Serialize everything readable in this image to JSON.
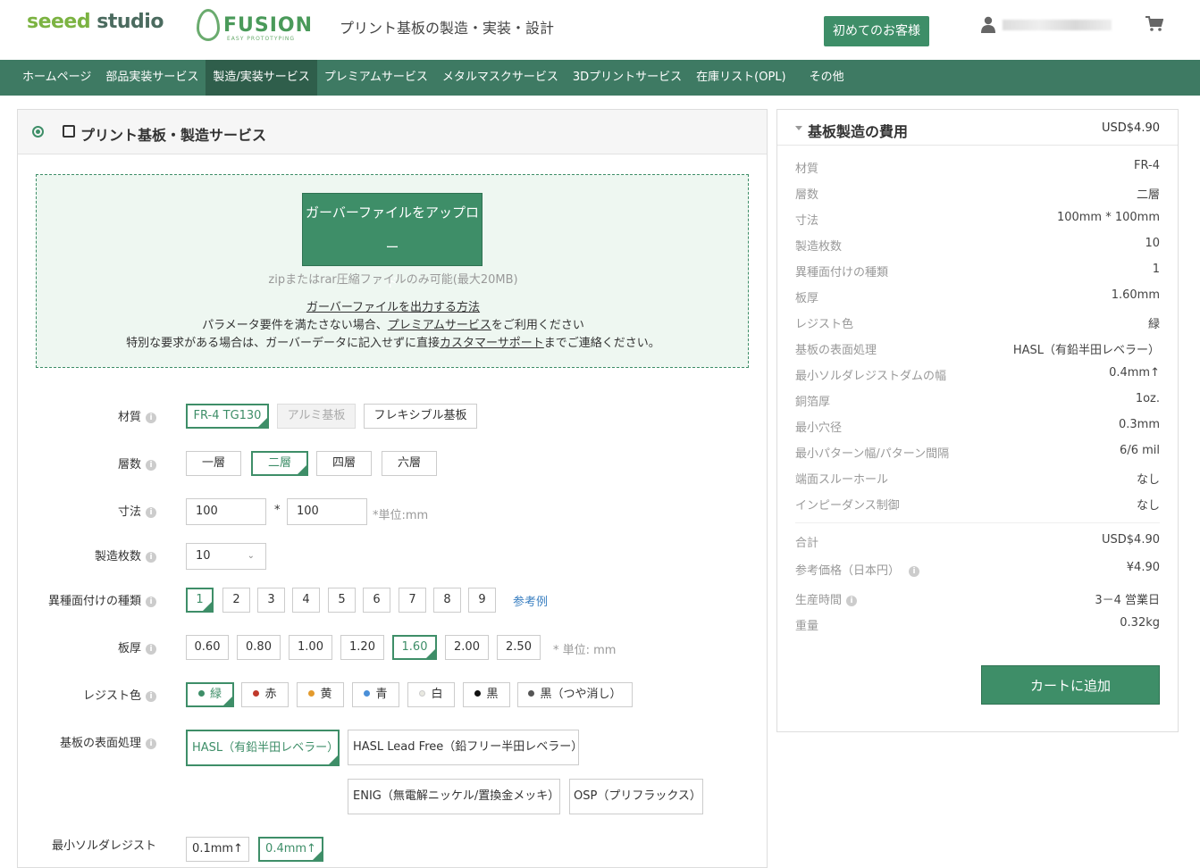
{
  "header": {
    "logo_seeed": "seeed",
    "logo_studio": "studio",
    "logo_fusion": "FUSION",
    "logo_fusion_sub": "EASY PROTOTYPING",
    "tagline": "プリント基板の製造・実装・設計",
    "first_customer_button": "初めてのお客様"
  },
  "nav": [
    "ホームページ",
    "部品実装サービス",
    "製造/実装サービス",
    "プレミアムサービス",
    "メタルマスクサービス",
    "3Dプリントサービス",
    "在庫リスト(OPL)",
    "その他"
  ],
  "nav_active_index": 2,
  "panel": {
    "title": "プリント基板・製造サービス",
    "upload_button_line1": "ガーバーファイルをアップロー",
    "upload_button_line2": "ド",
    "upload_note": "zipまたはrar圧縮ファイルのみ可能(最大20MB)",
    "gerber_howto_link": "ガーバーファイルを出力する方法",
    "premium_pre": "パラメータ要件を満たさない場合、",
    "premium_link": "プレミアムサービス",
    "premium_post": "をご利用ください",
    "support_pre": "特別な要求がある場合は、ガーバーデータに記入せずに直接",
    "support_link": "カスタマーサポート",
    "support_post": "までご連絡ください。"
  },
  "form": {
    "material": {
      "label": "材質",
      "options": [
        "FR-4 TG130",
        "アルミ基板",
        "フレキシブル基板"
      ]
    },
    "layers": {
      "label": "層数",
      "options": [
        "一層",
        "二層",
        "四層",
        "六層"
      ]
    },
    "size": {
      "label": "寸法",
      "width": "100",
      "height": "100",
      "times": "*",
      "unit": "*単位:mm"
    },
    "quantity": {
      "label": "製造枚数",
      "value": "10"
    },
    "designs": {
      "label": "異種面付けの種類",
      "options": [
        "1",
        "2",
        "3",
        "4",
        "5",
        "6",
        "7",
        "8",
        "9"
      ],
      "ref_link": "参考例"
    },
    "thickness": {
      "label": "板厚",
      "options": [
        "0.60",
        "0.80",
        "1.00",
        "1.20",
        "1.60",
        "2.00",
        "2.50"
      ],
      "unit": "* 単位: mm"
    },
    "solder_color": {
      "label": "レジスト色",
      "options": [
        {
          "name": "緑",
          "color": "#3e8e68"
        },
        {
          "name": "赤",
          "color": "#c0392b"
        },
        {
          "name": "黄",
          "color": "#e39a2d"
        },
        {
          "name": "青",
          "color": "#4a8fd8"
        },
        {
          "name": "白",
          "color": "#e8e8e0"
        },
        {
          "name": "黒",
          "color": "#111111"
        },
        {
          "name": "黒（つや消し）",
          "color": "#555555"
        }
      ]
    },
    "surface": {
      "label": "基板の表面処理",
      "options": [
        "HASL（有鉛半田レベラー）",
        "HASL Lead Free（鉛フリー半田レベラー）",
        "ENIG（無電解ニッケル/置換金メッキ）",
        "OSP（プリフラックス）"
      ]
    },
    "min_solder_dam": {
      "label": "最小ソルダレジスト",
      "options": [
        "0.1mm↑",
        "0.4mm↑"
      ]
    }
  },
  "summary": {
    "title": "基板製造の費用",
    "price": "USD$4.90",
    "specs": [
      {
        "k": "材質",
        "v": "FR-4"
      },
      {
        "k": "層数",
        "v": "二層"
      },
      {
        "k": "寸法",
        "v": "100mm * 100mm"
      },
      {
        "k": "製造枚数",
        "v": "10"
      },
      {
        "k": "異種面付けの種類",
        "v": "1"
      },
      {
        "k": "板厚",
        "v": "1.60mm"
      },
      {
        "k": "レジスト色",
        "v": "緑"
      },
      {
        "k": "基板の表面処理",
        "v": "HASL（有鉛半田レベラー）"
      },
      {
        "k": "最小ソルダレジストダムの幅",
        "v": "0.4mm↑"
      },
      {
        "k": "銅箔厚",
        "v": "1oz."
      },
      {
        "k": "最小穴径",
        "v": "0.3mm"
      },
      {
        "k": "最小パターン幅/パターン間隔",
        "v": "6/6 mil"
      },
      {
        "k": "端面スルーホール",
        "v": "なし"
      },
      {
        "k": "インピーダンス制御",
        "v": "なし"
      }
    ],
    "total_label": "合計",
    "total_value": "USD$4.90",
    "jpy_label": "参考価格（日本円）",
    "jpy_value": "¥4.90",
    "lead_label": "生産時間",
    "lead_value": "3－4 営業日",
    "weight_label": "重量",
    "weight_value": "0.32kg",
    "add_to_cart": "カートに追加"
  },
  "colors": {
    "accent": "#3e8e68",
    "nav_bg": "#3e7a63",
    "nav_active": "#2f5e4b"
  }
}
